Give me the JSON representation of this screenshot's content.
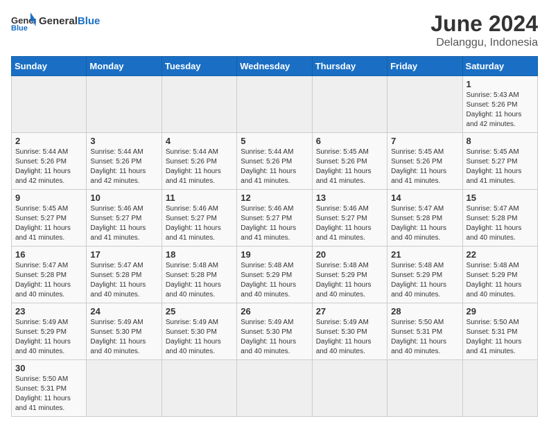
{
  "header": {
    "logo_general": "General",
    "logo_blue": "Blue",
    "title": "June 2024",
    "subtitle": "Delanggu, Indonesia"
  },
  "weekdays": [
    "Sunday",
    "Monday",
    "Tuesday",
    "Wednesday",
    "Thursday",
    "Friday",
    "Saturday"
  ],
  "weeks": [
    [
      {
        "day": "",
        "info": ""
      },
      {
        "day": "",
        "info": ""
      },
      {
        "day": "",
        "info": ""
      },
      {
        "day": "",
        "info": ""
      },
      {
        "day": "",
        "info": ""
      },
      {
        "day": "",
        "info": ""
      },
      {
        "day": "1",
        "info": "Sunrise: 5:43 AM\nSunset: 5:26 PM\nDaylight: 11 hours\nand 42 minutes."
      }
    ],
    [
      {
        "day": "2",
        "info": "Sunrise: 5:44 AM\nSunset: 5:26 PM\nDaylight: 11 hours\nand 42 minutes."
      },
      {
        "day": "3",
        "info": "Sunrise: 5:44 AM\nSunset: 5:26 PM\nDaylight: 11 hours\nand 42 minutes."
      },
      {
        "day": "4",
        "info": "Sunrise: 5:44 AM\nSunset: 5:26 PM\nDaylight: 11 hours\nand 41 minutes."
      },
      {
        "day": "5",
        "info": "Sunrise: 5:44 AM\nSunset: 5:26 PM\nDaylight: 11 hours\nand 41 minutes."
      },
      {
        "day": "6",
        "info": "Sunrise: 5:45 AM\nSunset: 5:26 PM\nDaylight: 11 hours\nand 41 minutes."
      },
      {
        "day": "7",
        "info": "Sunrise: 5:45 AM\nSunset: 5:26 PM\nDaylight: 11 hours\nand 41 minutes."
      },
      {
        "day": "8",
        "info": "Sunrise: 5:45 AM\nSunset: 5:27 PM\nDaylight: 11 hours\nand 41 minutes."
      }
    ],
    [
      {
        "day": "9",
        "info": "Sunrise: 5:45 AM\nSunset: 5:27 PM\nDaylight: 11 hours\nand 41 minutes."
      },
      {
        "day": "10",
        "info": "Sunrise: 5:46 AM\nSunset: 5:27 PM\nDaylight: 11 hours\nand 41 minutes."
      },
      {
        "day": "11",
        "info": "Sunrise: 5:46 AM\nSunset: 5:27 PM\nDaylight: 11 hours\nand 41 minutes."
      },
      {
        "day": "12",
        "info": "Sunrise: 5:46 AM\nSunset: 5:27 PM\nDaylight: 11 hours\nand 41 minutes."
      },
      {
        "day": "13",
        "info": "Sunrise: 5:46 AM\nSunset: 5:27 PM\nDaylight: 11 hours\nand 41 minutes."
      },
      {
        "day": "14",
        "info": "Sunrise: 5:47 AM\nSunset: 5:28 PM\nDaylight: 11 hours\nand 40 minutes."
      },
      {
        "day": "15",
        "info": "Sunrise: 5:47 AM\nSunset: 5:28 PM\nDaylight: 11 hours\nand 40 minutes."
      }
    ],
    [
      {
        "day": "16",
        "info": "Sunrise: 5:47 AM\nSunset: 5:28 PM\nDaylight: 11 hours\nand 40 minutes."
      },
      {
        "day": "17",
        "info": "Sunrise: 5:47 AM\nSunset: 5:28 PM\nDaylight: 11 hours\nand 40 minutes."
      },
      {
        "day": "18",
        "info": "Sunrise: 5:48 AM\nSunset: 5:28 PM\nDaylight: 11 hours\nand 40 minutes."
      },
      {
        "day": "19",
        "info": "Sunrise: 5:48 AM\nSunset: 5:29 PM\nDaylight: 11 hours\nand 40 minutes."
      },
      {
        "day": "20",
        "info": "Sunrise: 5:48 AM\nSunset: 5:29 PM\nDaylight: 11 hours\nand 40 minutes."
      },
      {
        "day": "21",
        "info": "Sunrise: 5:48 AM\nSunset: 5:29 PM\nDaylight: 11 hours\nand 40 minutes."
      },
      {
        "day": "22",
        "info": "Sunrise: 5:48 AM\nSunset: 5:29 PM\nDaylight: 11 hours\nand 40 minutes."
      }
    ],
    [
      {
        "day": "23",
        "info": "Sunrise: 5:49 AM\nSunset: 5:29 PM\nDaylight: 11 hours\nand 40 minutes."
      },
      {
        "day": "24",
        "info": "Sunrise: 5:49 AM\nSunset: 5:30 PM\nDaylight: 11 hours\nand 40 minutes."
      },
      {
        "day": "25",
        "info": "Sunrise: 5:49 AM\nSunset: 5:30 PM\nDaylight: 11 hours\nand 40 minutes."
      },
      {
        "day": "26",
        "info": "Sunrise: 5:49 AM\nSunset: 5:30 PM\nDaylight: 11 hours\nand 40 minutes."
      },
      {
        "day": "27",
        "info": "Sunrise: 5:49 AM\nSunset: 5:30 PM\nDaylight: 11 hours\nand 40 minutes."
      },
      {
        "day": "28",
        "info": "Sunrise: 5:50 AM\nSunset: 5:31 PM\nDaylight: 11 hours\nand 40 minutes."
      },
      {
        "day": "29",
        "info": "Sunrise: 5:50 AM\nSunset: 5:31 PM\nDaylight: 11 hours\nand 41 minutes."
      }
    ],
    [
      {
        "day": "30",
        "info": "Sunrise: 5:50 AM\nSunset: 5:31 PM\nDaylight: 11 hours\nand 41 minutes."
      },
      {
        "day": "",
        "info": ""
      },
      {
        "day": "",
        "info": ""
      },
      {
        "day": "",
        "info": ""
      },
      {
        "day": "",
        "info": ""
      },
      {
        "day": "",
        "info": ""
      },
      {
        "day": "",
        "info": ""
      }
    ]
  ]
}
